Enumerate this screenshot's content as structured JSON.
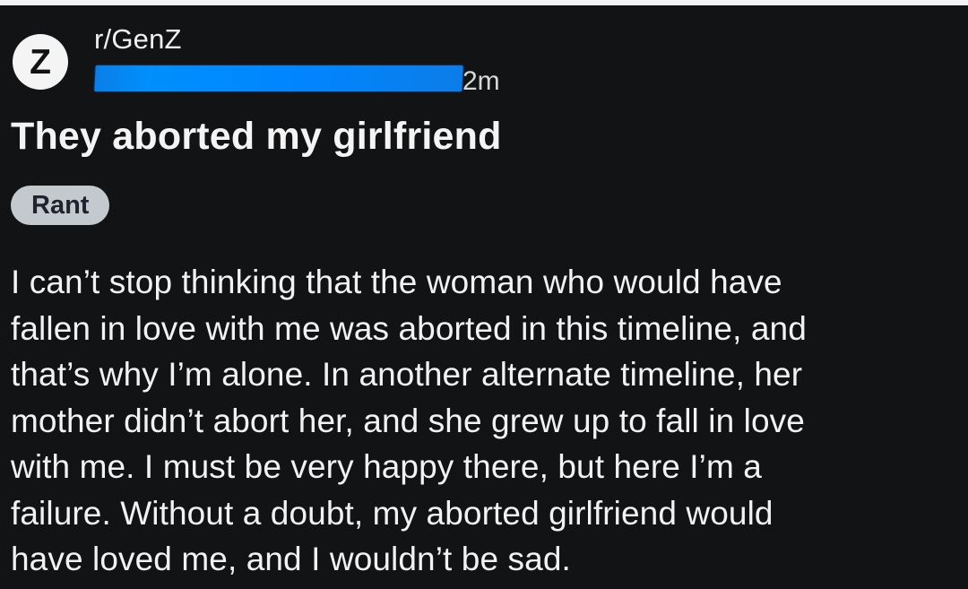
{
  "post": {
    "community": {
      "avatar_letter": "Z",
      "name": "r/GenZ"
    },
    "time": "2m",
    "title": "They aborted my girlfriend",
    "flair": "Rant",
    "body_lines": [
      "I can’t stop thinking that the woman who would have",
      "fallen in love with me was aborted in this timeline, and",
      "that’s why I’m alone. In another alternate timeline, her",
      "mother didn’t abort her, and she grew up to fall in love",
      "with me. I must be very happy there, but here I’m a",
      "failure. Without a doubt, my aborted girlfriend would",
      "have loved me, and I wouldn’t be sad."
    ]
  },
  "colors": {
    "background": "#121315",
    "text": "#f2f2f2",
    "redaction": "#008ffb",
    "flair_background": "#c4c9cd"
  },
  "icons": {
    "community_avatar": "letter-z-avatar"
  }
}
